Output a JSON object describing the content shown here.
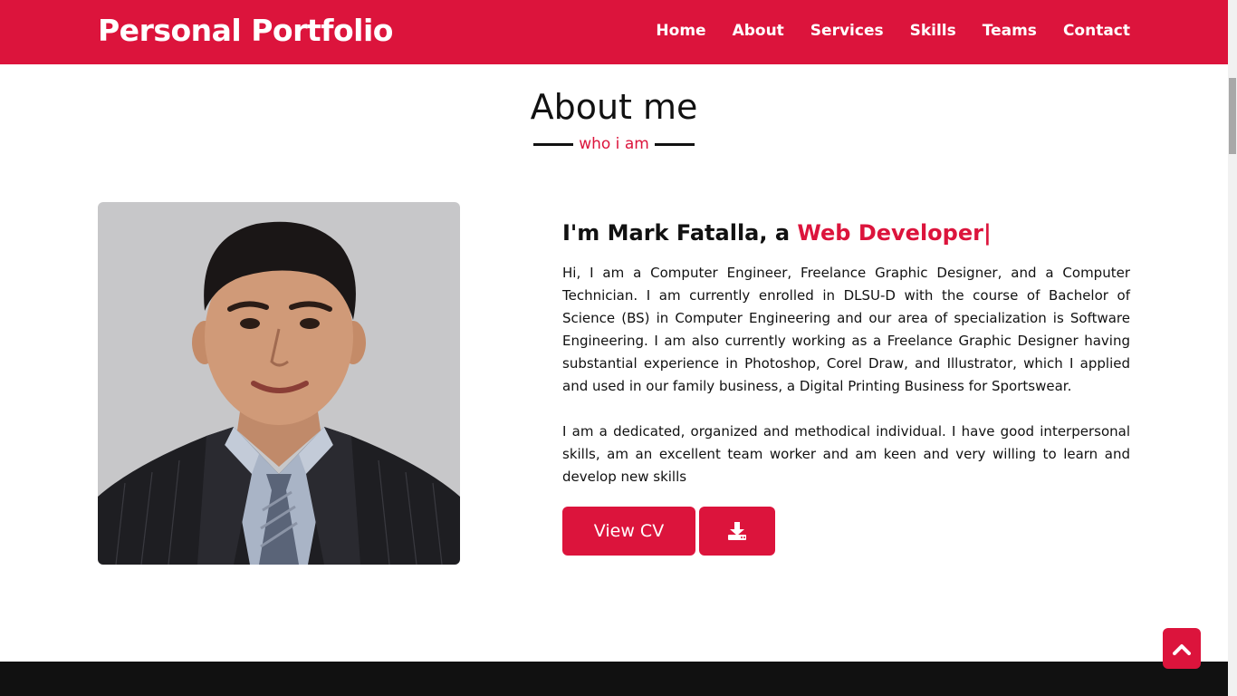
{
  "nav": {
    "brand": "Personal Portfolio",
    "items": [
      {
        "label": "Home"
      },
      {
        "label": "About"
      },
      {
        "label": "Services"
      },
      {
        "label": "Skills"
      },
      {
        "label": "Teams"
      },
      {
        "label": "Contact"
      }
    ]
  },
  "about": {
    "title": "About me",
    "subtitle": "who i am",
    "headline_prefix": "I'm Mark Fatalla, a ",
    "headline_role": "Web Developer|",
    "paragraph1": "Hi, I am a Computer Engineer, Freelance Graphic Designer, and a Computer Technician. I am currently enrolled in DLSU-D with the course of Bachelor of Science (BS) in Computer Engineering and our area of specialization is Software Engineering. I am also currently working as a Freelance Graphic Designer having substantial experience in Photoshop, Corel Draw, and Illustrator, which I applied and used in our family business, a Digital Printing Business for Sportswear.",
    "paragraph2": "I am a dedicated, organized and methodical individual. I have good interpersonal skills, am an excellent team worker and am keen and very willing to learn and develop new skills",
    "view_cv_label": "View CV"
  },
  "icons": {
    "download": "download-icon",
    "back_to_top": "chevron-up-icon"
  },
  "colors": {
    "accent": "#dc143c",
    "footer": "#111111",
    "photo_bg": "#c7c7c9"
  }
}
